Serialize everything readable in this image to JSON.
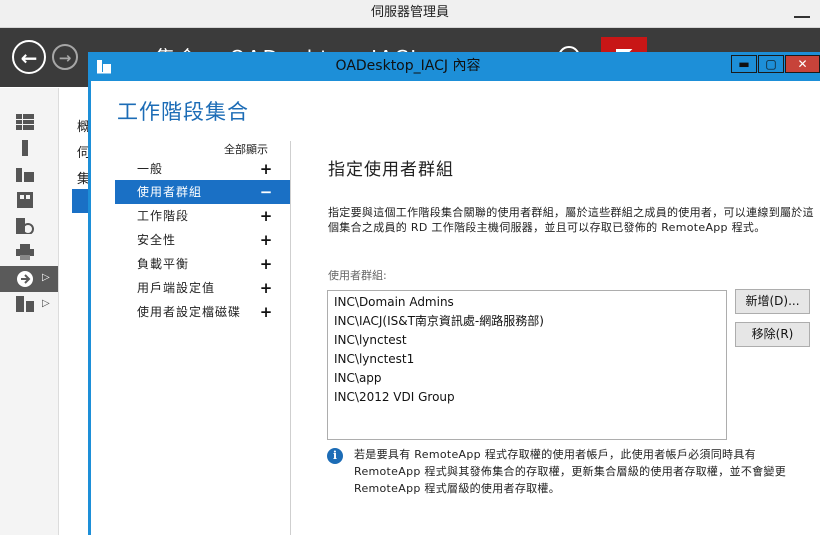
{
  "background_window": {
    "title": "伺服器管理員",
    "header_text": "集合 ‣ OADesktop_IACJ",
    "side_list": [
      "概",
      "伺",
      "集"
    ]
  },
  "dialog": {
    "title": "OADesktop_IACJ 內容",
    "heading": "工作階段集合",
    "nav_show_all": "全部顯示",
    "nav": [
      {
        "label": "一般",
        "sign": "+"
      },
      {
        "label": "使用者群組",
        "sign": "−"
      },
      {
        "label": "工作階段",
        "sign": "+"
      },
      {
        "label": "安全性",
        "sign": "+"
      },
      {
        "label": "負載平衡",
        "sign": "+"
      },
      {
        "label": "用戶端設定值",
        "sign": "+"
      },
      {
        "label": "使用者設定檔磁碟",
        "sign": "+"
      }
    ],
    "section_title": "指定使用者群組",
    "description": "指定要與這個工作階段集合關聯的使用者群組，屬於這些群組之成員的使用者，可以連線到屬於這個集合之成員的 RD 工作階段主機伺服器，並且可以存取已發佈的 RemoteApp 程式。",
    "groups_label": "使用者群組:",
    "groups": [
      "INC\\Domain Admins",
      "INC\\IACJ(IS&T南京資訊處-網路服務部)",
      "INC\\lynctest",
      "INC\\lynctest1",
      "INC\\app",
      "INC\\2012 VDI Group"
    ],
    "add_button": "新增(D)...",
    "remove_button": "移除(R)",
    "info_text": "若是要具有 RemoteApp 程式存取權的使用者帳戶，此使用者帳戶必須同時具有 RemoteApp 程式與其發佈集合的存取權，更新集合層級的使用者存取權，並不會變更 RemoteApp 程式層級的使用者存取權。",
    "info_icon": "i"
  },
  "colors": {
    "accent": "#1d8fd8",
    "selected": "#1a70c5",
    "heading": "#1c6cb6",
    "close": "#c7433a"
  }
}
